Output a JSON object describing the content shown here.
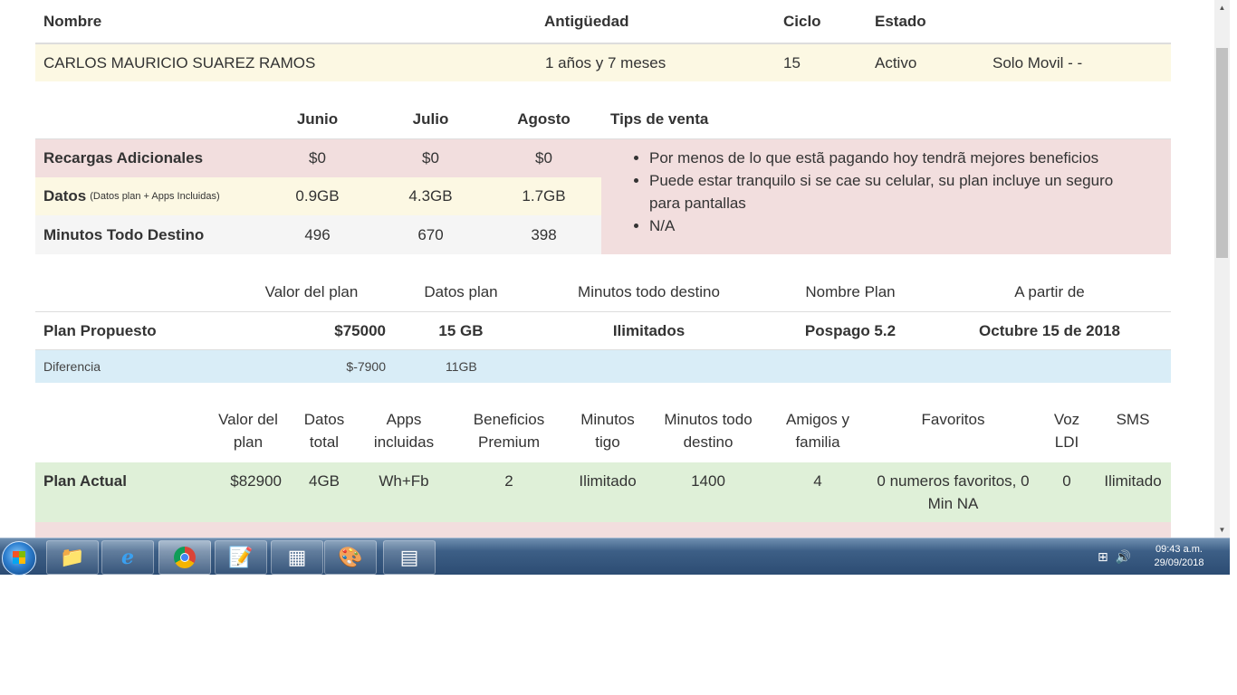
{
  "customer": {
    "headers": {
      "name": "Nombre",
      "age": "Antigüedad",
      "cycle": "Ciclo",
      "status": "Estado"
    },
    "name": "CARLOS MAURICIO SUAREZ RAMOS",
    "age": "1 años y 7 meses",
    "cycle": "15",
    "status": "Activo",
    "service": "Solo Movil - -"
  },
  "usage": {
    "months": [
      "Junio",
      "Julio",
      "Agosto"
    ],
    "tips_header": "Tips de venta",
    "rows": [
      {
        "label": "Recargas Adicionales",
        "note": "",
        "values": [
          "$0",
          "$0",
          "$0"
        ]
      },
      {
        "label": "Datos",
        "note": "(Datos plan + Apps Incluidas)",
        "values": [
          "0.9GB",
          "4.3GB",
          "1.7GB"
        ]
      },
      {
        "label": "Minutos Todo Destino",
        "note": "",
        "values": [
          "496",
          "670",
          "398"
        ]
      }
    ],
    "tips": [
      "Por menos de lo que estã pagando hoy tendrã mejores beneficios",
      "Puede estar tranquilo si se cae su celular, su plan incluye un seguro para pantallas",
      "N/A"
    ]
  },
  "proposed": {
    "headers": {
      "value": "Valor del plan",
      "data": "Datos plan",
      "minutes": "Minutos todo destino",
      "name": "Nombre Plan",
      "from": "A partir de"
    },
    "label": "Plan Propuesto",
    "value": "$75000",
    "data": "15 GB",
    "minutes": "Ilimitados",
    "name": "Pospago 5.2",
    "from": "Octubre 15 de 2018",
    "diff_label": "Diferencia",
    "diff_value": "$-7900",
    "diff_data": "11GB"
  },
  "current": {
    "headers": {
      "value": "Valor del plan",
      "data": "Datos total",
      "apps": "Apps incluidas",
      "benefits": "Beneficios Premium",
      "min_tigo": "Minutos tigo",
      "min_all": "Minutos todo destino",
      "friends": "Amigos y familia",
      "favorites": "Favoritos",
      "ldi": "Voz LDI",
      "sms": "SMS"
    },
    "label": "Plan Actual",
    "value": "$82900",
    "data": "4GB",
    "apps": "Wh+Fb",
    "benefits": "2",
    "min_tigo": "Ilimitado",
    "min_all": "1400",
    "friends": "4",
    "favorites": "0 numeros favoritos, 0 Min NA",
    "ldi": "0",
    "sms": "Ilimitado"
  },
  "taskbar": {
    "apps": [
      "folder-icon",
      "internet-explorer-icon",
      "chrome-icon",
      "notepad-icon",
      "spreadsheet-icon",
      "paint-icon",
      "calculator-icon"
    ],
    "time": "09:43 a.m.",
    "date": "29/09/2018"
  }
}
